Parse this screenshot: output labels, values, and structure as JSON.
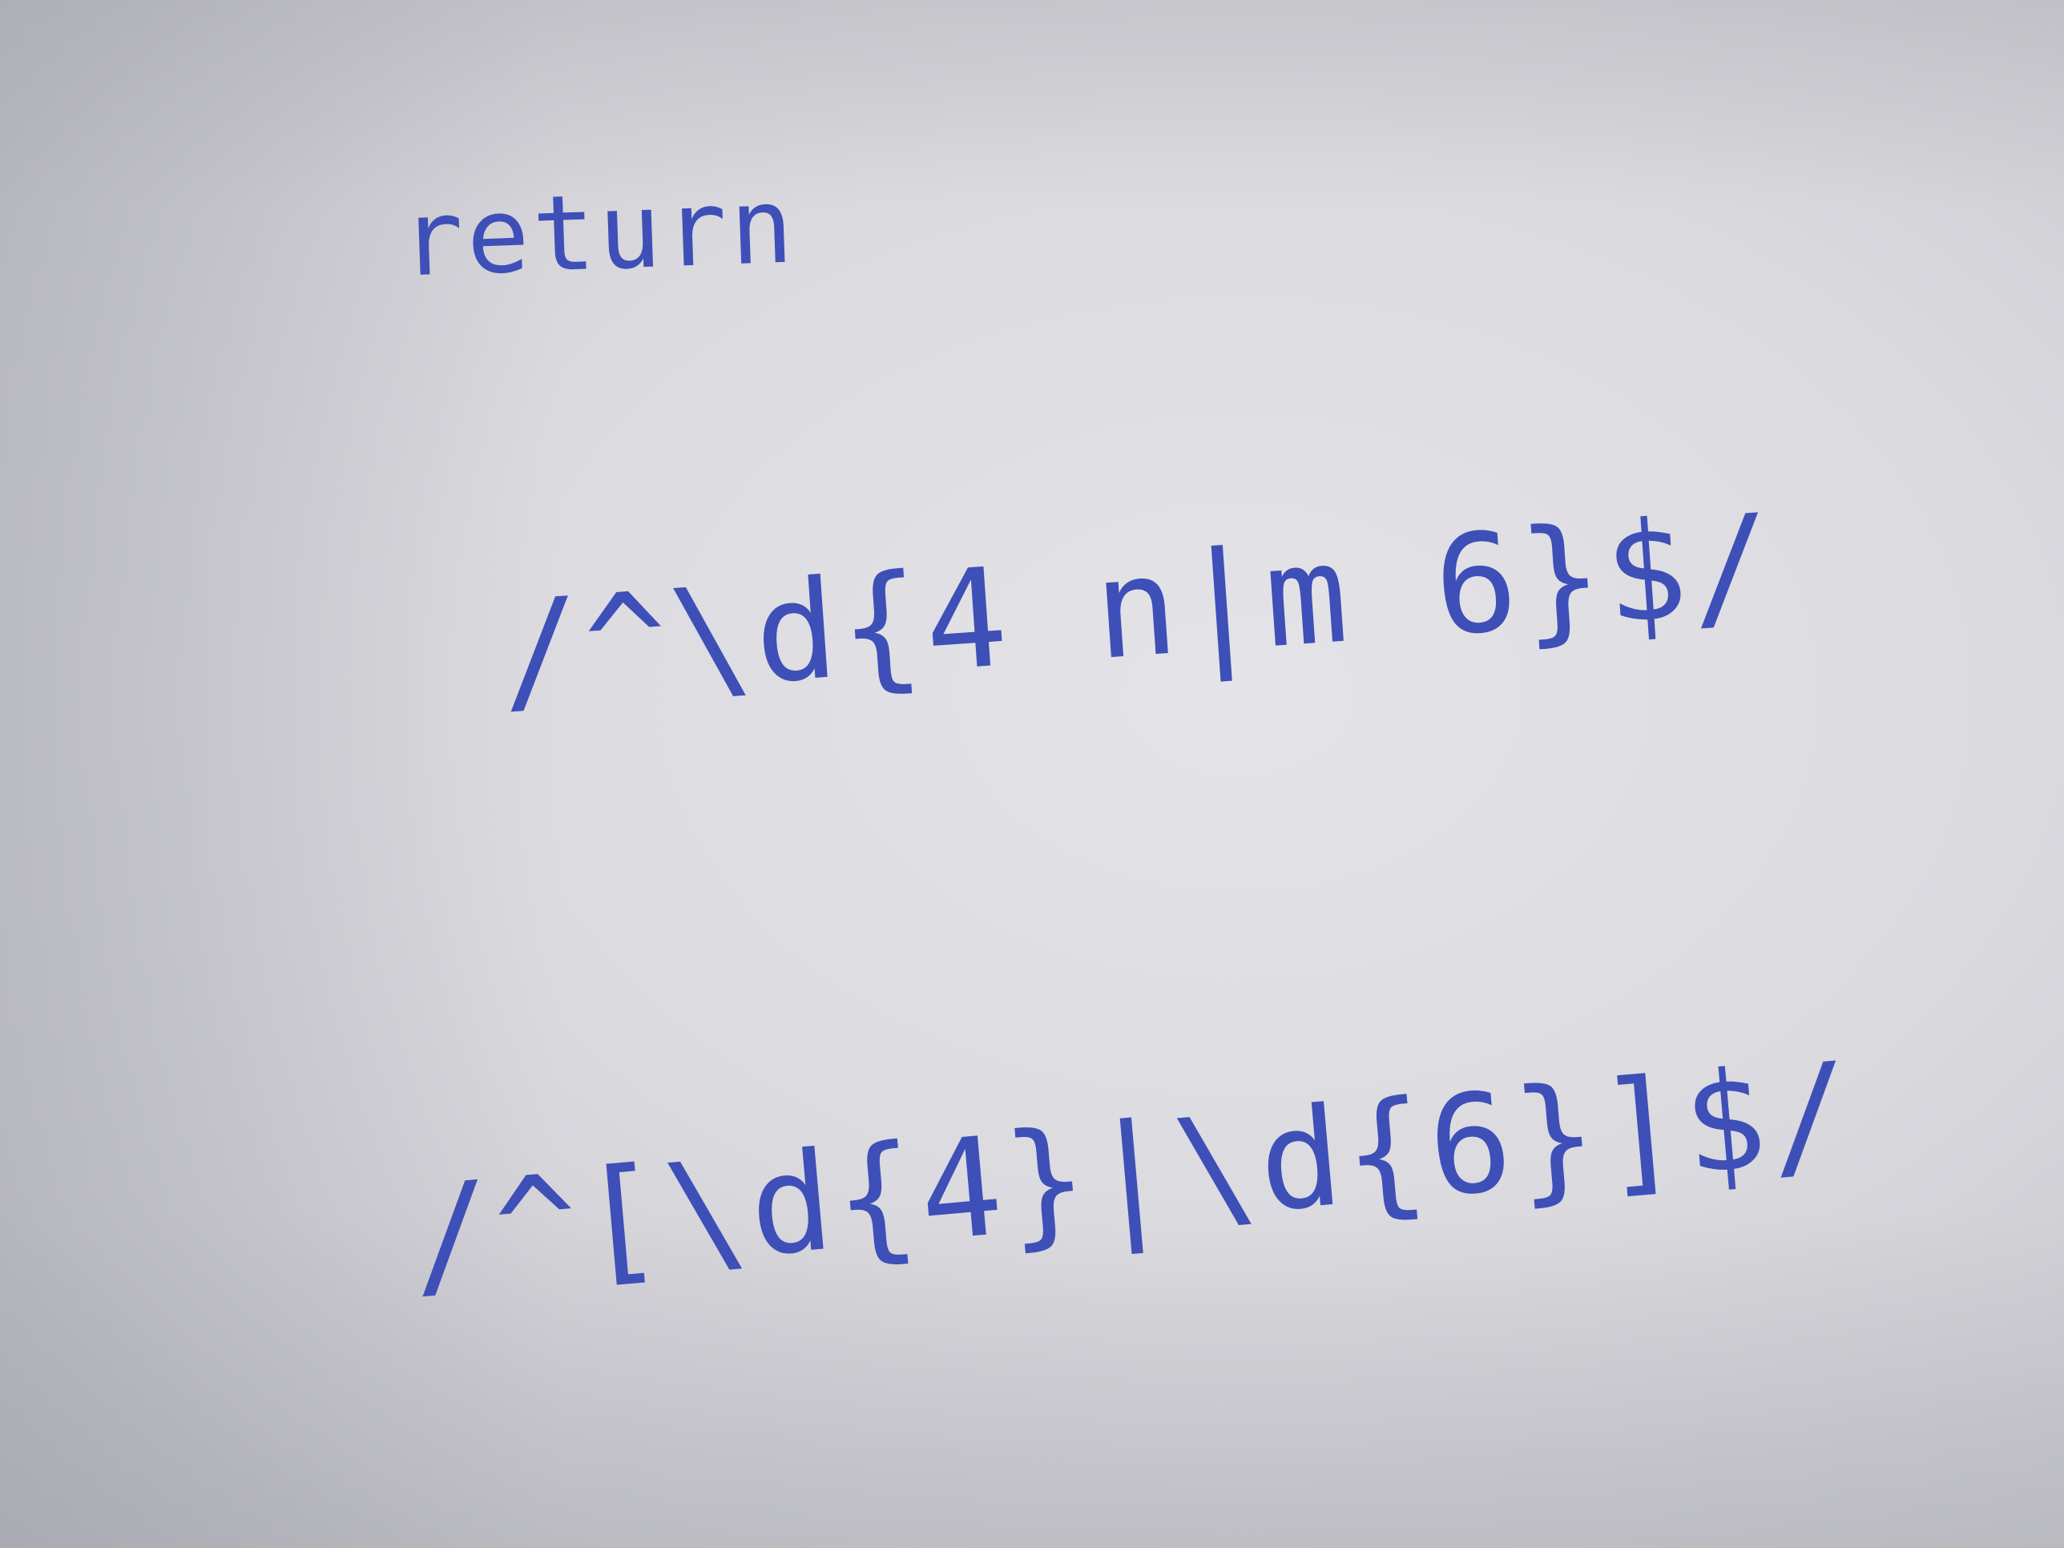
{
  "note": {
    "lines": [
      "return",
      "/^\\d{4 n|m 6}$/",
      "/^[\\d{4}|\\d{6}]$/"
    ],
    "ink_color": "#3e4fb8",
    "paper_color": "#dadadf"
  }
}
